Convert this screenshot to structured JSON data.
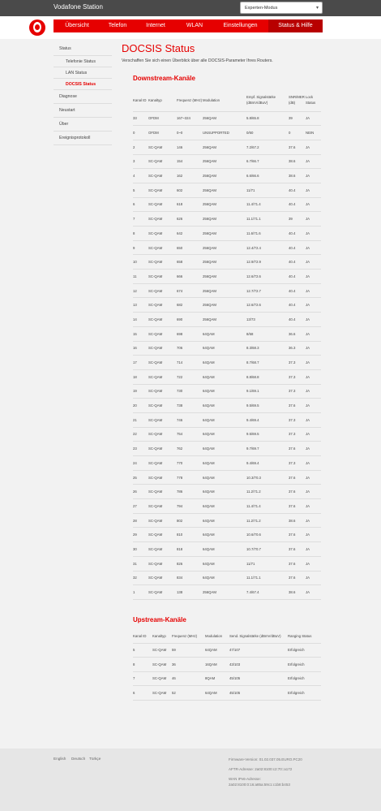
{
  "topbar": {
    "title": "Vodafone Station",
    "mode": "Experten-Modus"
  },
  "nav": {
    "items": [
      "Übersicht",
      "Telefon",
      "Internet",
      "WLAN",
      "Einstellungen",
      "Status & Hilfe"
    ],
    "active": "Status & Hilfe"
  },
  "sidebar": {
    "items": [
      {
        "label": "Status"
      },
      {
        "label": "Telefonie Status"
      },
      {
        "label": "LAN Status"
      },
      {
        "label": "DOCSIS Status"
      },
      {
        "label": "Diagnose"
      },
      {
        "label": "Neustart"
      },
      {
        "label": "Über"
      },
      {
        "label": "Ereignisprotokoll"
      }
    ]
  },
  "page": {
    "title": "DOCSIS Status",
    "description": "Verschaffen Sie sich einen Überblick über alle DOCSIS-Parameter Ihres Routers."
  },
  "downstream": {
    "title": "Downstream-Kanäle",
    "headers": [
      "Kanal ID",
      "Kanaltyp",
      "Frequenz (MHz)",
      "Modulation",
      "Empf. Signalstärke (dBmV/dBuV)",
      "SNR/MER (dB)",
      "Lock Status"
    ],
    "rows": [
      [
        "33",
        "OFDM",
        "167~324",
        "256QAM",
        "5.8/65.8",
        "39",
        "JA"
      ],
      [
        "0",
        "OFDM",
        "0~0",
        "UNSUPPORTED",
        "0/60",
        "0",
        "NEIN"
      ],
      [
        "2",
        "SC-QAM",
        "146",
        "256QAM",
        "7.2/67.2",
        "37.6",
        "JA"
      ],
      [
        "3",
        "SC-QAM",
        "154",
        "256QAM",
        "6.7/66.7",
        "38.6",
        "JA"
      ],
      [
        "4",
        "SC-QAM",
        "162",
        "256QAM",
        "6.6/66.6",
        "38.6",
        "JA"
      ],
      [
        "5",
        "SC-QAM",
        "602",
        "256QAM",
        "11/71",
        "40.4",
        "JA"
      ],
      [
        "6",
        "SC-QAM",
        "618",
        "256QAM",
        "11.4/71.4",
        "40.4",
        "JA"
      ],
      [
        "7",
        "SC-QAM",
        "626",
        "256QAM",
        "11.1/71.1",
        "39",
        "JA"
      ],
      [
        "8",
        "SC-QAM",
        "642",
        "256QAM",
        "11.6/71.6",
        "40.4",
        "JA"
      ],
      [
        "9",
        "SC-QAM",
        "650",
        "256QAM",
        "12.4/72.4",
        "40.4",
        "JA"
      ],
      [
        "10",
        "SC-QAM",
        "658",
        "256QAM",
        "12.9/72.9",
        "40.4",
        "JA"
      ],
      [
        "11",
        "SC-QAM",
        "666",
        "256QAM",
        "12.6/72.6",
        "40.4",
        "JA"
      ],
      [
        "12",
        "SC-QAM",
        "674",
        "256QAM",
        "12.7/72.7",
        "40.4",
        "JA"
      ],
      [
        "13",
        "SC-QAM",
        "682",
        "256QAM",
        "12.6/72.6",
        "40.4",
        "JA"
      ],
      [
        "14",
        "SC-QAM",
        "690",
        "256QAM",
        "13/73",
        "40.4",
        "JA"
      ],
      [
        "15",
        "SC-QAM",
        "698",
        "64QAM",
        "8/68",
        "36.6",
        "JA"
      ],
      [
        "16",
        "SC-QAM",
        "706",
        "64QAM",
        "8.3/68.3",
        "36.3",
        "JA"
      ],
      [
        "17",
        "SC-QAM",
        "714",
        "64QAM",
        "8.7/68.7",
        "37.3",
        "JA"
      ],
      [
        "18",
        "SC-QAM",
        "722",
        "64QAM",
        "8.8/68.8",
        "37.3",
        "JA"
      ],
      [
        "19",
        "SC-QAM",
        "730",
        "64QAM",
        "9.1/69.1",
        "37.3",
        "JA"
      ],
      [
        "20",
        "SC-QAM",
        "738",
        "64QAM",
        "9.5/69.5",
        "37.6",
        "JA"
      ],
      [
        "21",
        "SC-QAM",
        "746",
        "64QAM",
        "9.4/69.4",
        "37.3",
        "JA"
      ],
      [
        "22",
        "SC-QAM",
        "754",
        "64QAM",
        "9.5/69.5",
        "37.3",
        "JA"
      ],
      [
        "23",
        "SC-QAM",
        "762",
        "64QAM",
        "9.7/69.7",
        "37.6",
        "JA"
      ],
      [
        "24",
        "SC-QAM",
        "770",
        "64QAM",
        "9.4/69.4",
        "37.3",
        "JA"
      ],
      [
        "25",
        "SC-QAM",
        "778",
        "64QAM",
        "10.3/70.3",
        "37.6",
        "JA"
      ],
      [
        "26",
        "SC-QAM",
        "786",
        "64QAM",
        "11.2/71.2",
        "37.6",
        "JA"
      ],
      [
        "27",
        "SC-QAM",
        "794",
        "64QAM",
        "11.4/71.4",
        "37.6",
        "JA"
      ],
      [
        "28",
        "SC-QAM",
        "802",
        "64QAM",
        "11.2/71.2",
        "38.6",
        "JA"
      ],
      [
        "29",
        "SC-QAM",
        "810",
        "64QAM",
        "10.6/70.6",
        "37.6",
        "JA"
      ],
      [
        "30",
        "SC-QAM",
        "818",
        "64QAM",
        "10.7/70.7",
        "37.6",
        "JA"
      ],
      [
        "31",
        "SC-QAM",
        "826",
        "64QAM",
        "11/71",
        "37.6",
        "JA"
      ],
      [
        "32",
        "SC-QAM",
        "834",
        "64QAM",
        "11.1/71.1",
        "37.6",
        "JA"
      ],
      [
        "1",
        "SC-QAM",
        "138",
        "256QAM",
        "7.4/67.4",
        "38.6",
        "JA"
      ]
    ]
  },
  "upstream": {
    "title": "Upstream-Kanäle",
    "headers": [
      "Kanal ID",
      "Kanaltyp",
      "Frequenz (MHz)",
      "Modulation",
      "Send. Signalstärke (dBmV/dBuV)",
      "Ranging Status"
    ],
    "rows": [
      [
        "5",
        "SC-QAM",
        "59",
        "64QAM",
        "47/107",
        "Erfolgreich"
      ],
      [
        "8",
        "SC-QAM",
        "36",
        "16QAM",
        "43/103",
        "Erfolgreich"
      ],
      [
        "7",
        "SC-QAM",
        "46",
        "8QAM",
        "45/105",
        "Erfolgreich"
      ],
      [
        "6",
        "SC-QAM",
        "52",
        "64QAM",
        "45/105",
        "Erfolgreich"
      ]
    ]
  },
  "footer": {
    "languages": [
      "English",
      "Deutsch",
      "Türkçe"
    ],
    "firmware": "Firmware-Version: 01.02.037.05.EURO.PC20",
    "aftr": "AFTR-Adresse: 2a02:8100:c2:70::a172",
    "wan_label": "WAN IPv6-Adresse:",
    "wan_value": "2a02:8100:0:16:a85a:59c1:c1b8:b453"
  },
  "colors": {
    "brand_red": "#e60000",
    "topbar": "#4a4a4a"
  }
}
